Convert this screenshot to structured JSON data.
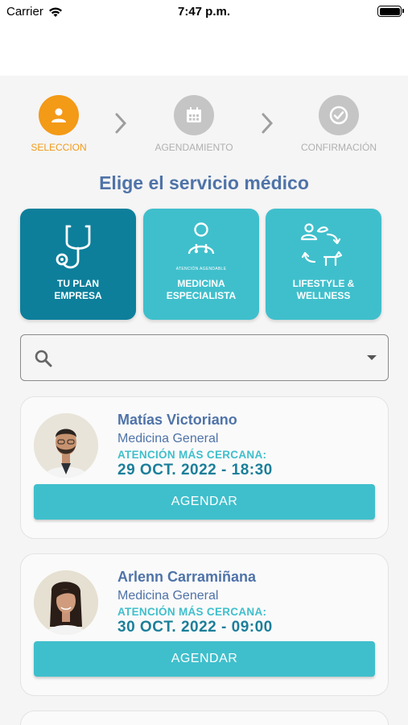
{
  "status_bar": {
    "carrier": "Carrier",
    "time": "7:47 p.m."
  },
  "stepper": {
    "steps": [
      {
        "label": "SELECCION",
        "icon": "person-icon",
        "state": "active"
      },
      {
        "label": "AGENDAMIENTO",
        "icon": "calendar-icon",
        "state": "pending"
      },
      {
        "label": "CONFIRMACIÓN",
        "icon": "check-circle-icon",
        "state": "pending"
      }
    ]
  },
  "title": "Elige el servicio médico",
  "services": [
    {
      "label_line1": "TU PLAN",
      "label_line2": "EMPRESA",
      "icon": "stethoscope-icon",
      "selected": true
    },
    {
      "label_line1": "MEDICINA",
      "label_line2": "ESPECIALISTA",
      "small_text": "ATENCIÓN AGENDABLE",
      "icon": "doctor-icon",
      "selected": false
    },
    {
      "label_line1": "LIFESTYLE &",
      "label_line2": "WELLNESS",
      "icon": "lifestyle-cycle-icon",
      "selected": false
    }
  ],
  "search": {
    "value": "",
    "icon": "search-icon"
  },
  "doctors": [
    {
      "name": "Matías Victoriano",
      "specialty": "Medicina General",
      "next_label": "ATENCIÓN MÁS CERCANA:",
      "next_date": "29 OCT. 2022 - 18:30",
      "button": "AGENDAR"
    },
    {
      "name": "Arlenn Carramiñana",
      "specialty": "Medicina General",
      "next_label": "ATENCIÓN MÁS CERCANA:",
      "next_date": "30 OCT. 2022 - 09:00",
      "button": "AGENDAR"
    }
  ],
  "colors": {
    "accent_orange": "#f39a17",
    "primary_blue": "#4f73a8",
    "teal": "#3fbfcc",
    "dark_teal": "#0d7f9b"
  }
}
